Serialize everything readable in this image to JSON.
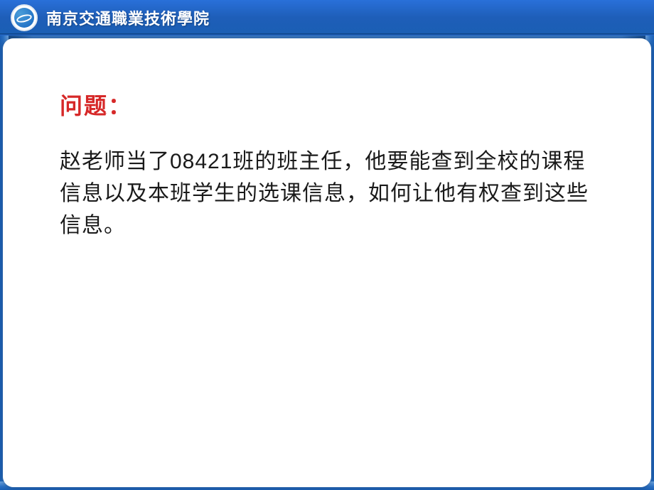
{
  "header": {
    "school_name": "南京交通職業技術學院"
  },
  "content": {
    "title": "问题：",
    "body": "赵老师当了08421班的班主任，他要能查到全校的课程信息以及本班学生的选课信息，如何让他有权查到这些信息。"
  }
}
